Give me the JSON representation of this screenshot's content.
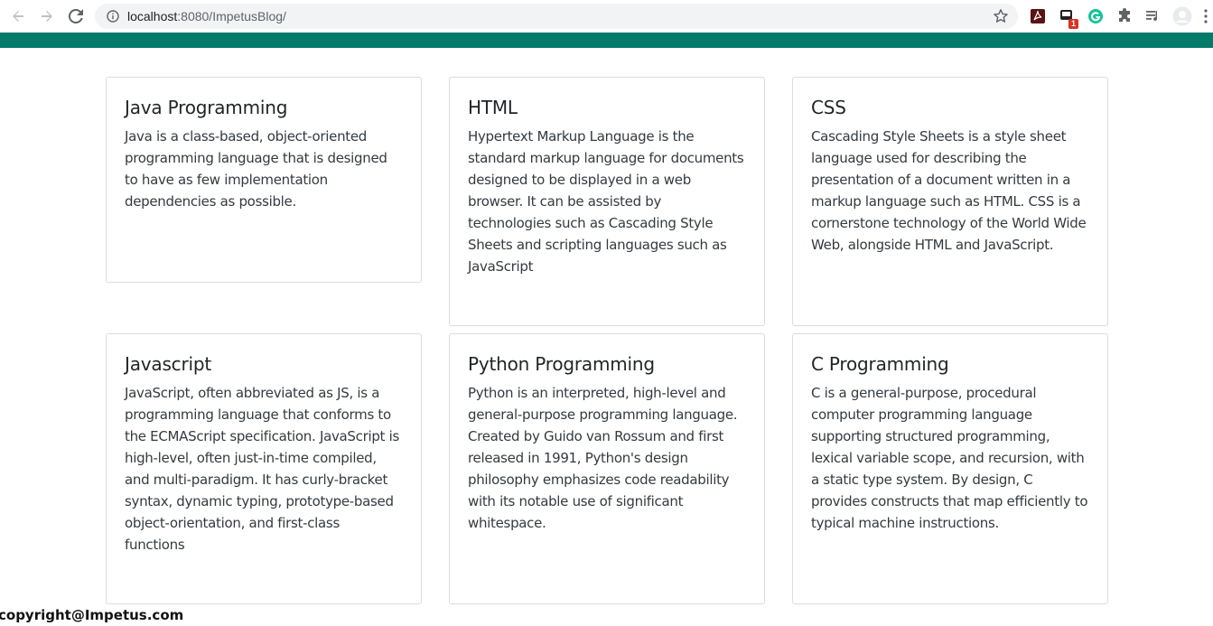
{
  "browser": {
    "url_host": "localhost",
    "url_rest": ":8080/ImpetusBlog/",
    "extension_badge": "1"
  },
  "cards": [
    {
      "title": "Java Programming",
      "text": "Java is a class-based, object-oriented programming language that is designed to have as few implementation dependencies as possible."
    },
    {
      "title": "HTML",
      "text": "Hypertext Markup Language is the standard markup language for documents designed to be displayed in a web browser. It can be assisted by technologies such as Cascading Style Sheets and scripting languages such as JavaScript"
    },
    {
      "title": "CSS",
      "text": "Cascading Style Sheets is a style sheet language used for describing the presentation of a document written in a markup language such as HTML. CSS is a cornerstone technology of the World Wide Web, alongside HTML and JavaScript."
    },
    {
      "title": "Javascript",
      "text": "JavaScript, often abbreviated as JS, is a programming language that conforms to the ECMAScript specification. JavaScript is high-level, often just-in-time compiled, and multi-paradigm. It has curly-bracket syntax, dynamic typing, prototype-based object-orientation, and first-class functions"
    },
    {
      "title": "Python Programming",
      "text": "Python is an interpreted, high-level and general-purpose programming language. Created by Guido van Rossum and first released in 1991, Python's design philosophy emphasizes code readability with its notable use of significant whitespace."
    },
    {
      "title": "C Programming",
      "text": "C is a general-purpose, procedural computer programming language supporting structured programming, lexical variable scope, and recursion, with a static type system. By design, C provides constructs that map efficiently to typical machine instructions."
    }
  ],
  "footer": {
    "copyright": "copyright@Impetus.com"
  },
  "colors": {
    "header_bar": "#047a6a"
  }
}
